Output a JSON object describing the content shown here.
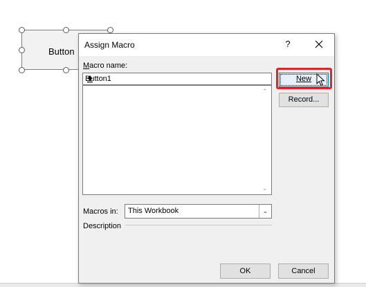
{
  "sheet": {
    "button_label": "Button"
  },
  "dialog": {
    "title": "Assign Macro",
    "help_glyph": "?",
    "macro_name_label": "Macro name:",
    "macro_name_value": "Button1",
    "new_button": "New",
    "record_button": "Record...",
    "macros_in_label": "Macros in:",
    "macros_in_value": "This Workbook",
    "description_label": "Description",
    "ok_button": "OK",
    "cancel_button": "Cancel"
  },
  "colors": {
    "highlight": "#e0242a",
    "focus_border": "#0078d7"
  },
  "icons": [
    "close-icon",
    "upload-arrow-icon",
    "scroll-up-icon",
    "scroll-down-icon",
    "chevron-down-icon",
    "mouse-pointer-icon"
  ]
}
